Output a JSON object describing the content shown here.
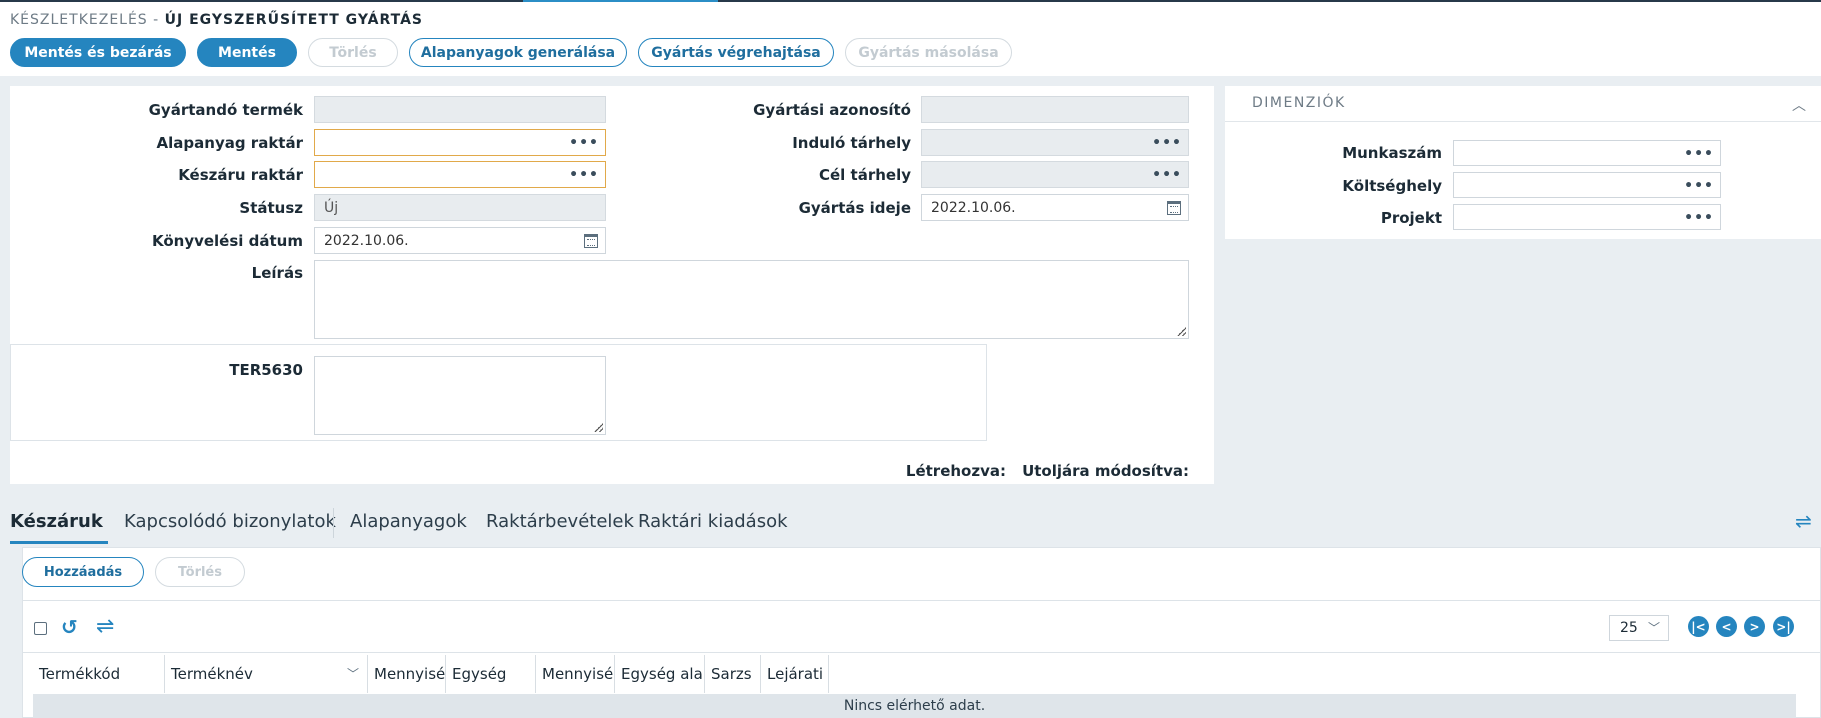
{
  "header": {
    "breadcrumb": "KÉSZLETKEZELÉS -",
    "title": "ÚJ EGYSZERŰSÍTETT GYÁRTÁS"
  },
  "toolbar": {
    "save_close": "Mentés és bezárás",
    "save": "Mentés",
    "delete": "Törlés",
    "generate_materials": "Alapanyagok generálása",
    "execute_production": "Gyártás végrehajtása",
    "copy_production": "Gyártás másolása"
  },
  "form": {
    "product_label": "Gyártandó termék",
    "product_value": "",
    "raw_warehouse_label": "Alapanyag raktár",
    "raw_warehouse_value": "",
    "finished_warehouse_label": "Készáru raktár",
    "finished_warehouse_value": "",
    "status_label": "Státusz",
    "status_value": "Új",
    "posting_date_label": "Könyvelési dátum",
    "posting_date_value": "2022.10.06.",
    "production_id_label": "Gyártási azonosító",
    "production_id_value": "",
    "start_location_label": "Induló tárhely",
    "start_location_value": "",
    "target_location_label": "Cél tárhely",
    "target_location_value": "",
    "production_time_label": "Gyártás ideje",
    "production_time_value": "2022.10.06.",
    "description_label": "Leírás",
    "custom_field_label": "TER5630",
    "created_label": "Létrehozva:",
    "modified_label": "Utoljára módosítva:"
  },
  "dimensions": {
    "title": "DIMENZIÓK",
    "work_number_label": "Munkaszám",
    "cost_center_label": "Költséghely",
    "project_label": "Projekt"
  },
  "tabs": [
    {
      "label": "Készáruk"
    },
    {
      "label": "Kapcsolódó bizonylatok"
    },
    {
      "label": "Alapanyagok"
    },
    {
      "label": "Raktárbevételek"
    },
    {
      "label": "Raktári kiadások"
    }
  ],
  "grid": {
    "add_button": "Hozzáadás",
    "delete_button": "Törlés",
    "page_size": "25",
    "columns": [
      "Termékkód",
      "Terméknév",
      "Mennyiség",
      "Egység",
      "Mennyiség",
      "Egység alap",
      "Sarzs",
      "Lejárati d"
    ],
    "empty_text": "Nincs elérhető adat."
  },
  "colors": {
    "accent": "#2585bf",
    "required_border": "#e1a94a",
    "dark_bar": "#27394a"
  }
}
